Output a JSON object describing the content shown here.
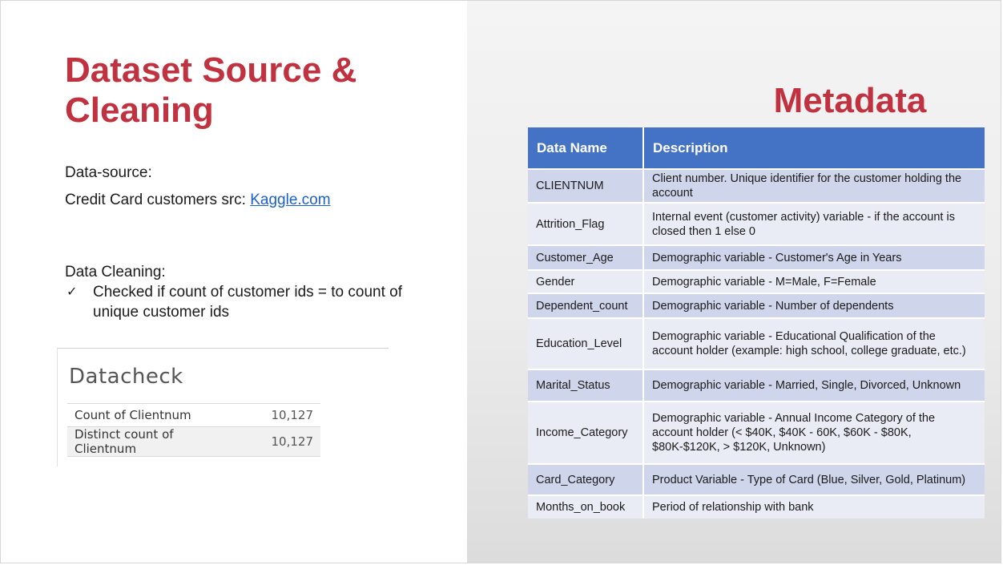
{
  "slide": {
    "title": "Dataset Source & Cleaning",
    "metadata_title": "Metadata"
  },
  "source": {
    "label": "Data-source:",
    "prefix": "Credit Card customers src: ",
    "link_text": "Kaggle.com"
  },
  "cleaning": {
    "label": "Data Cleaning:",
    "check_glyph": "✓",
    "item": "Checked if count of customer ids = to count of unique customer ids"
  },
  "datacheck": {
    "title": "Datacheck",
    "rows": [
      {
        "label": "Count of Clientnum",
        "value": "10,127"
      },
      {
        "label": "Distinct count of Clientnum",
        "value": "10,127"
      }
    ]
  },
  "metadata": {
    "headers": [
      "Data Name",
      "Description"
    ],
    "rows": [
      {
        "name": "CLIENTNUM",
        "description": "Client number. Unique identifier for the customer holding the account"
      },
      {
        "name": "Attrition_Flag",
        "description": "Internal event (customer activity) variable - if the account is closed then 1 else 0"
      },
      {
        "name": "Customer_Age",
        "description": "Demographic variable - Customer's Age in Years"
      },
      {
        "name": "Gender",
        "description": "Demographic variable - M=Male, F=Female"
      },
      {
        "name": "Dependent_count",
        "description": "Demographic variable - Number of dependents"
      },
      {
        "name": "Education_Level",
        "description": "Demographic variable - Educational Qualification of the account holder (example: high school, college graduate, etc.)"
      },
      {
        "name": "Marital_Status",
        "description": "Demographic variable - Married, Single, Divorced, Unknown"
      },
      {
        "name": "Income_Category",
        "description": "Demographic variable - Annual Income Category of the account holder (< $40K, $40K - 60K, $60K - $80K, $80K-$120K, > $120K, Unknown)"
      },
      {
        "name": "Card_Category",
        "description": "Product Variable - Type of Card (Blue, Silver, Gold, Platinum)"
      },
      {
        "name": "Months_on_book",
        "description": "Period of relationship with bank"
      }
    ]
  },
  "colors": {
    "title_red": "#c0323f",
    "header_blue": "#4472c4",
    "row_dark": "#cfd5ea",
    "row_light": "#e9ebf5",
    "link_blue": "#1a5fcc"
  }
}
